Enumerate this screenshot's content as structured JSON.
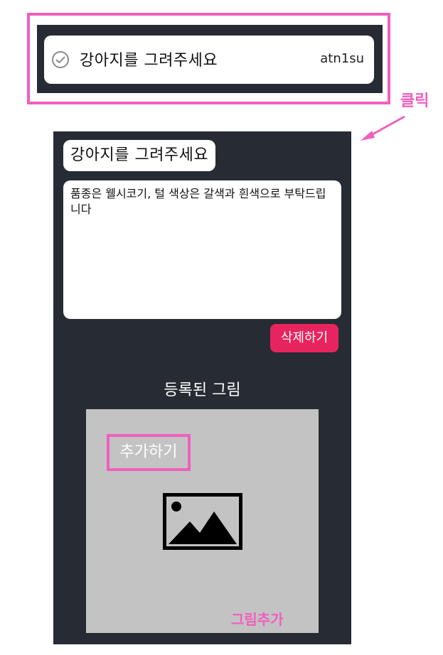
{
  "list_item": {
    "title": "강아지를 그려주세요",
    "user": "atn1su",
    "status_icon": "check-circle-icon"
  },
  "annotations": {
    "click": "클릭",
    "add_picture": "그림추가",
    "highlight_color": "#f05fbe"
  },
  "detail": {
    "title": "강아지를 그려주세요",
    "description": "품종은 웰시코기, 털 색상은 갈색과 흰색으로 부탁드립니다",
    "delete_label": "삭제하기",
    "section_title": "등록된 그림",
    "image_placeholder_icon": "image-icon",
    "add_label": "추가하기"
  },
  "colors": {
    "panel_bg": "#272b33",
    "delete_bg": "#e8245e",
    "image_bg": "#c3c3c3"
  }
}
